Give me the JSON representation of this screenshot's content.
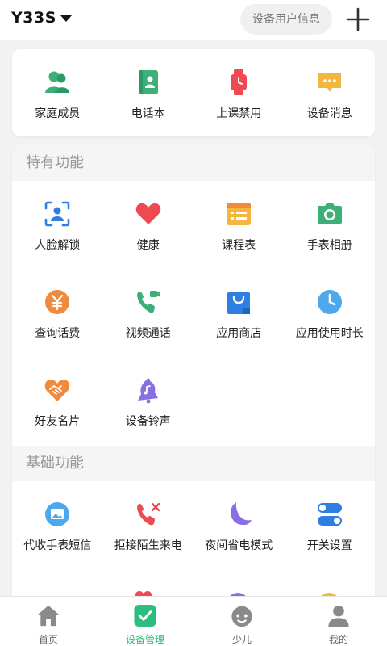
{
  "header": {
    "device_name": "Y33S",
    "info_button": "设备用户信息"
  },
  "top_items": [
    {
      "label": "家庭成员",
      "icon": "family-members-icon"
    },
    {
      "label": "电话本",
      "icon": "phonebook-icon"
    },
    {
      "label": "上课禁用",
      "icon": "class-disable-watch-icon"
    },
    {
      "label": "设备消息",
      "icon": "device-message-icon"
    }
  ],
  "special": {
    "title": "特有功能",
    "items": [
      {
        "label": "人脸解锁"
      },
      {
        "label": "健康"
      },
      {
        "label": "课程表"
      },
      {
        "label": "手表相册"
      },
      {
        "label": "查询话费"
      },
      {
        "label": "视频通话"
      },
      {
        "label": "应用商店"
      },
      {
        "label": "应用使用时长"
      },
      {
        "label": "好友名片"
      },
      {
        "label": "设备铃声"
      }
    ]
  },
  "basic": {
    "title": "基础功能",
    "items": [
      {
        "label": "代收手表短信"
      },
      {
        "label": "拒接陌生来电"
      },
      {
        "label": "夜间省电模式"
      },
      {
        "label": "开关设置"
      }
    ]
  },
  "tabs": [
    {
      "label": "首页"
    },
    {
      "label": "设备管理"
    },
    {
      "label": "少儿"
    },
    {
      "label": "我的"
    }
  ],
  "colors": {
    "accent_green": "#2dbd7e",
    "heart_red": "#ef4a52",
    "orange": "#f08a3c",
    "yellow": "#f5b640",
    "blue": "#2f7fe0",
    "purple": "#8a6fe0",
    "light_blue": "#4ea8ec"
  }
}
